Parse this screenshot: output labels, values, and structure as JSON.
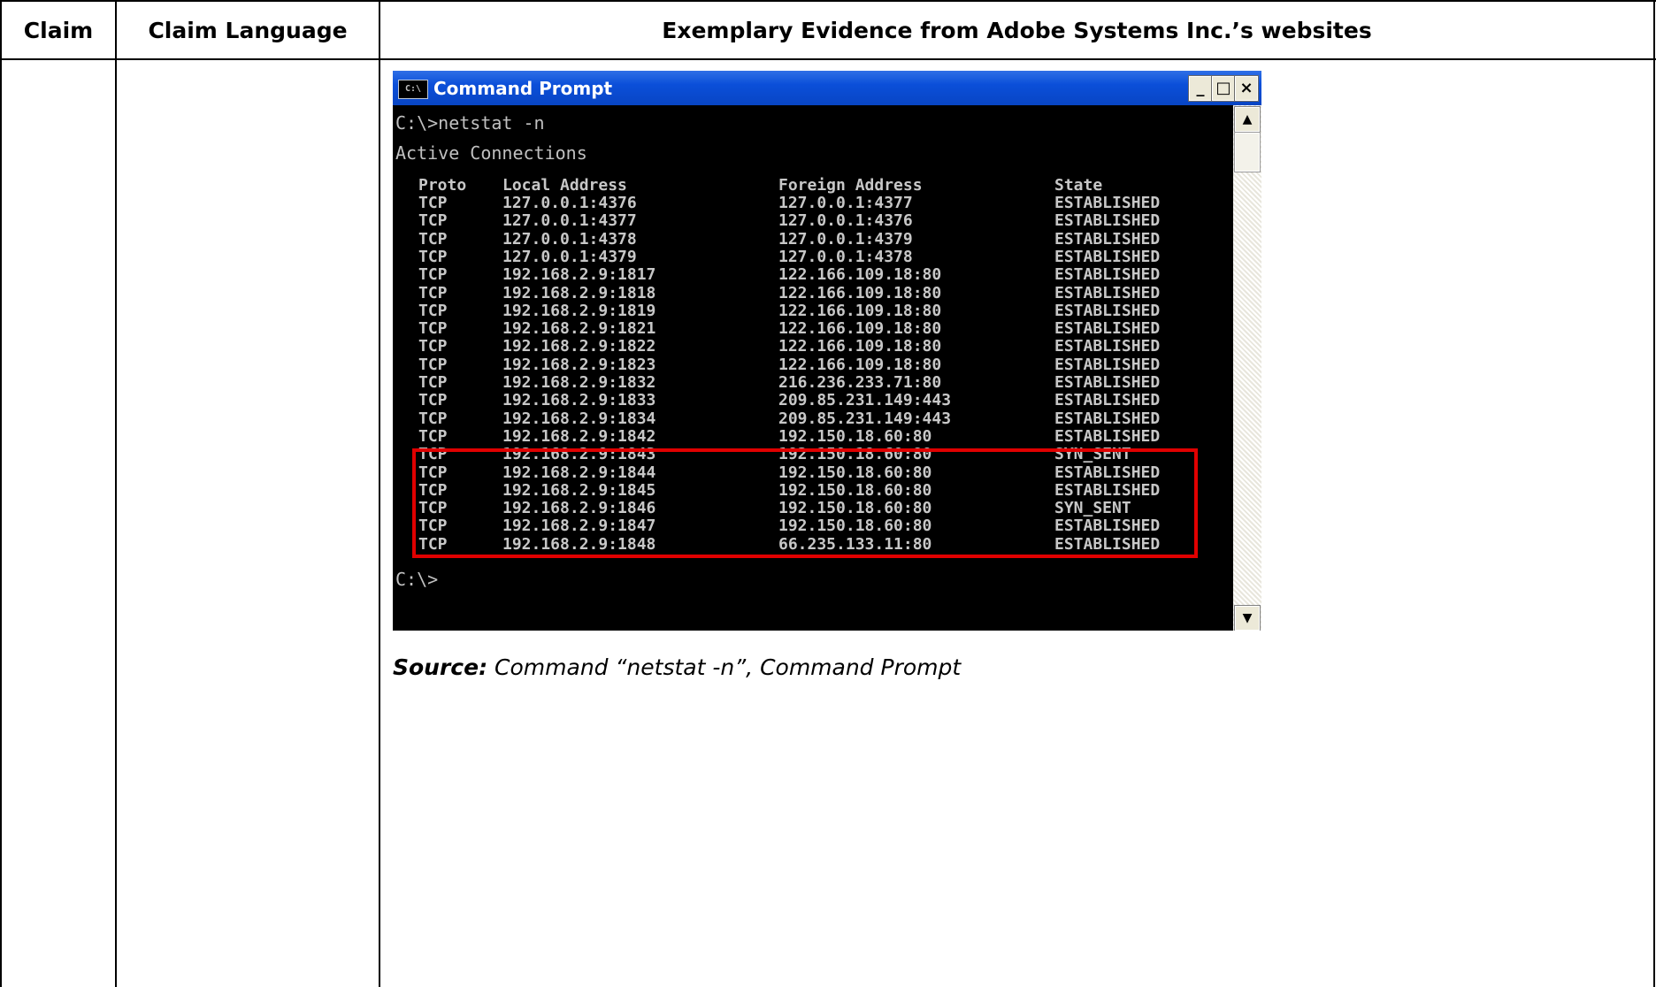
{
  "table": {
    "headers": {
      "claim": "Claim",
      "claim_language": "Claim Language",
      "evidence": "Exemplary Evidence from Adobe Systems Inc.’s websites"
    }
  },
  "window": {
    "title": "Command Prompt",
    "icon_label": "C:\\",
    "buttons": {
      "minimize": "_",
      "maximize": "□",
      "close": "×"
    }
  },
  "console": {
    "command": "C:\\>netstat -n",
    "heading": "Active Connections",
    "columns": [
      "Proto",
      "Local Address",
      "Foreign Address",
      "State"
    ],
    "rows": [
      [
        "TCP",
        "127.0.0.1:4376",
        "127.0.0.1:4377",
        "ESTABLISHED"
      ],
      [
        "TCP",
        "127.0.0.1:4377",
        "127.0.0.1:4376",
        "ESTABLISHED"
      ],
      [
        "TCP",
        "127.0.0.1:4378",
        "127.0.0.1:4379",
        "ESTABLISHED"
      ],
      [
        "TCP",
        "127.0.0.1:4379",
        "127.0.0.1:4378",
        "ESTABLISHED"
      ],
      [
        "TCP",
        "192.168.2.9:1817",
        "122.166.109.18:80",
        "ESTABLISHED"
      ],
      [
        "TCP",
        "192.168.2.9:1818",
        "122.166.109.18:80",
        "ESTABLISHED"
      ],
      [
        "TCP",
        "192.168.2.9:1819",
        "122.166.109.18:80",
        "ESTABLISHED"
      ],
      [
        "TCP",
        "192.168.2.9:1821",
        "122.166.109.18:80",
        "ESTABLISHED"
      ],
      [
        "TCP",
        "192.168.2.9:1822",
        "122.166.109.18:80",
        "ESTABLISHED"
      ],
      [
        "TCP",
        "192.168.2.9:1823",
        "122.166.109.18:80",
        "ESTABLISHED"
      ],
      [
        "TCP",
        "192.168.2.9:1832",
        "216.236.233.71:80",
        "ESTABLISHED"
      ],
      [
        "TCP",
        "192.168.2.9:1833",
        "209.85.231.149:443",
        "ESTABLISHED"
      ],
      [
        "TCP",
        "192.168.2.9:1834",
        "209.85.231.149:443",
        "ESTABLISHED"
      ],
      [
        "TCP",
        "192.168.2.9:1842",
        "192.150.18.60:80",
        "ESTABLISHED"
      ],
      [
        "TCP",
        "192.168.2.9:1843",
        "192.150.18.60:80",
        "SYN_SENT"
      ],
      [
        "TCP",
        "192.168.2.9:1844",
        "192.150.18.60:80",
        "ESTABLISHED"
      ],
      [
        "TCP",
        "192.168.2.9:1845",
        "192.150.18.60:80",
        "ESTABLISHED"
      ],
      [
        "TCP",
        "192.168.2.9:1846",
        "192.150.18.60:80",
        "SYN_SENT"
      ],
      [
        "TCP",
        "192.168.2.9:1847",
        "192.150.18.60:80",
        "ESTABLISHED"
      ],
      [
        "TCP",
        "192.168.2.9:1848",
        "66.235.133.11:80",
        "ESTABLISHED"
      ]
    ],
    "prompt": "C:\\>"
  },
  "caption": {
    "label": "Source:",
    "text": " Command “netstat -n”, Command Prompt"
  },
  "colors": {
    "titlebar": "#0b4fd9",
    "console_bg": "#000000",
    "console_text": "#c0c0c0",
    "highlight_box": "#e00000"
  }
}
